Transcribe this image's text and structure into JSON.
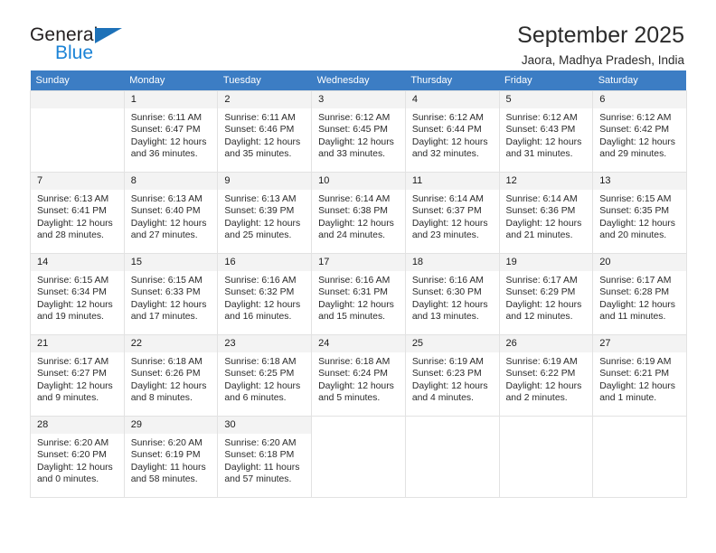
{
  "brand": {
    "name_top": "General",
    "name_bottom": "Blue",
    "accent_color": "#1b83d6",
    "triangle_color": "#1d71b8"
  },
  "header": {
    "title": "September 2025",
    "subtitle": "Jaora, Madhya Pradesh, India",
    "header_bg": "#3c7dc4",
    "header_text_color": "#ffffff"
  },
  "weekdays": [
    "Sunday",
    "Monday",
    "Tuesday",
    "Wednesday",
    "Thursday",
    "Friday",
    "Saturday"
  ],
  "labels": {
    "sunrise": "Sunrise:",
    "sunset": "Sunset:",
    "daylight": "Daylight:"
  },
  "weeks": [
    [
      {
        "empty": true
      },
      {
        "day": "1",
        "sunrise": "Sunrise: 6:11 AM",
        "sunset": "Sunset: 6:47 PM",
        "daylight_1": "Daylight: 12 hours",
        "daylight_2": "and 36 minutes."
      },
      {
        "day": "2",
        "sunrise": "Sunrise: 6:11 AM",
        "sunset": "Sunset: 6:46 PM",
        "daylight_1": "Daylight: 12 hours",
        "daylight_2": "and 35 minutes."
      },
      {
        "day": "3",
        "sunrise": "Sunrise: 6:12 AM",
        "sunset": "Sunset: 6:45 PM",
        "daylight_1": "Daylight: 12 hours",
        "daylight_2": "and 33 minutes."
      },
      {
        "day": "4",
        "sunrise": "Sunrise: 6:12 AM",
        "sunset": "Sunset: 6:44 PM",
        "daylight_1": "Daylight: 12 hours",
        "daylight_2": "and 32 minutes."
      },
      {
        "day": "5",
        "sunrise": "Sunrise: 6:12 AM",
        "sunset": "Sunset: 6:43 PM",
        "daylight_1": "Daylight: 12 hours",
        "daylight_2": "and 31 minutes."
      },
      {
        "day": "6",
        "sunrise": "Sunrise: 6:12 AM",
        "sunset": "Sunset: 6:42 PM",
        "daylight_1": "Daylight: 12 hours",
        "daylight_2": "and 29 minutes."
      }
    ],
    [
      {
        "day": "7",
        "sunrise": "Sunrise: 6:13 AM",
        "sunset": "Sunset: 6:41 PM",
        "daylight_1": "Daylight: 12 hours",
        "daylight_2": "and 28 minutes."
      },
      {
        "day": "8",
        "sunrise": "Sunrise: 6:13 AM",
        "sunset": "Sunset: 6:40 PM",
        "daylight_1": "Daylight: 12 hours",
        "daylight_2": "and 27 minutes."
      },
      {
        "day": "9",
        "sunrise": "Sunrise: 6:13 AM",
        "sunset": "Sunset: 6:39 PM",
        "daylight_1": "Daylight: 12 hours",
        "daylight_2": "and 25 minutes."
      },
      {
        "day": "10",
        "sunrise": "Sunrise: 6:14 AM",
        "sunset": "Sunset: 6:38 PM",
        "daylight_1": "Daylight: 12 hours",
        "daylight_2": "and 24 minutes."
      },
      {
        "day": "11",
        "sunrise": "Sunrise: 6:14 AM",
        "sunset": "Sunset: 6:37 PM",
        "daylight_1": "Daylight: 12 hours",
        "daylight_2": "and 23 minutes."
      },
      {
        "day": "12",
        "sunrise": "Sunrise: 6:14 AM",
        "sunset": "Sunset: 6:36 PM",
        "daylight_1": "Daylight: 12 hours",
        "daylight_2": "and 21 minutes."
      },
      {
        "day": "13",
        "sunrise": "Sunrise: 6:15 AM",
        "sunset": "Sunset: 6:35 PM",
        "daylight_1": "Daylight: 12 hours",
        "daylight_2": "and 20 minutes."
      }
    ],
    [
      {
        "day": "14",
        "sunrise": "Sunrise: 6:15 AM",
        "sunset": "Sunset: 6:34 PM",
        "daylight_1": "Daylight: 12 hours",
        "daylight_2": "and 19 minutes."
      },
      {
        "day": "15",
        "sunrise": "Sunrise: 6:15 AM",
        "sunset": "Sunset: 6:33 PM",
        "daylight_1": "Daylight: 12 hours",
        "daylight_2": "and 17 minutes."
      },
      {
        "day": "16",
        "sunrise": "Sunrise: 6:16 AM",
        "sunset": "Sunset: 6:32 PM",
        "daylight_1": "Daylight: 12 hours",
        "daylight_2": "and 16 minutes."
      },
      {
        "day": "17",
        "sunrise": "Sunrise: 6:16 AM",
        "sunset": "Sunset: 6:31 PM",
        "daylight_1": "Daylight: 12 hours",
        "daylight_2": "and 15 minutes."
      },
      {
        "day": "18",
        "sunrise": "Sunrise: 6:16 AM",
        "sunset": "Sunset: 6:30 PM",
        "daylight_1": "Daylight: 12 hours",
        "daylight_2": "and 13 minutes."
      },
      {
        "day": "19",
        "sunrise": "Sunrise: 6:17 AM",
        "sunset": "Sunset: 6:29 PM",
        "daylight_1": "Daylight: 12 hours",
        "daylight_2": "and 12 minutes."
      },
      {
        "day": "20",
        "sunrise": "Sunrise: 6:17 AM",
        "sunset": "Sunset: 6:28 PM",
        "daylight_1": "Daylight: 12 hours",
        "daylight_2": "and 11 minutes."
      }
    ],
    [
      {
        "day": "21",
        "sunrise": "Sunrise: 6:17 AM",
        "sunset": "Sunset: 6:27 PM",
        "daylight_1": "Daylight: 12 hours",
        "daylight_2": "and 9 minutes."
      },
      {
        "day": "22",
        "sunrise": "Sunrise: 6:18 AM",
        "sunset": "Sunset: 6:26 PM",
        "daylight_1": "Daylight: 12 hours",
        "daylight_2": "and 8 minutes."
      },
      {
        "day": "23",
        "sunrise": "Sunrise: 6:18 AM",
        "sunset": "Sunset: 6:25 PM",
        "daylight_1": "Daylight: 12 hours",
        "daylight_2": "and 6 minutes."
      },
      {
        "day": "24",
        "sunrise": "Sunrise: 6:18 AM",
        "sunset": "Sunset: 6:24 PM",
        "daylight_1": "Daylight: 12 hours",
        "daylight_2": "and 5 minutes."
      },
      {
        "day": "25",
        "sunrise": "Sunrise: 6:19 AM",
        "sunset": "Sunset: 6:23 PM",
        "daylight_1": "Daylight: 12 hours",
        "daylight_2": "and 4 minutes."
      },
      {
        "day": "26",
        "sunrise": "Sunrise: 6:19 AM",
        "sunset": "Sunset: 6:22 PM",
        "daylight_1": "Daylight: 12 hours",
        "daylight_2": "and 2 minutes."
      },
      {
        "day": "27",
        "sunrise": "Sunrise: 6:19 AM",
        "sunset": "Sunset: 6:21 PM",
        "daylight_1": "Daylight: 12 hours",
        "daylight_2": "and 1 minute."
      }
    ],
    [
      {
        "day": "28",
        "sunrise": "Sunrise: 6:20 AM",
        "sunset": "Sunset: 6:20 PM",
        "daylight_1": "Daylight: 12 hours",
        "daylight_2": "and 0 minutes."
      },
      {
        "day": "29",
        "sunrise": "Sunrise: 6:20 AM",
        "sunset": "Sunset: 6:19 PM",
        "daylight_1": "Daylight: 11 hours",
        "daylight_2": "and 58 minutes."
      },
      {
        "day": "30",
        "sunrise": "Sunrise: 6:20 AM",
        "sunset": "Sunset: 6:18 PM",
        "daylight_1": "Daylight: 11 hours",
        "daylight_2": "and 57 minutes."
      },
      {
        "blank": true
      },
      {
        "blank": true
      },
      {
        "blank": true
      },
      {
        "blank": true
      }
    ]
  ]
}
